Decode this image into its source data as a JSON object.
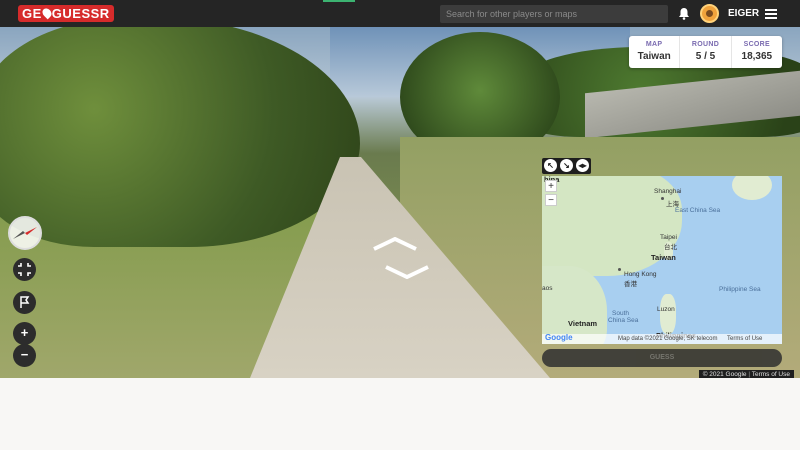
{
  "app": {
    "logo_text_left": "GE",
    "logo_text_right": "GUESSR",
    "brand_color": "#d62b2b",
    "search_placeholder": "Search for other players or maps",
    "username": "EIGER"
  },
  "scoreboard": {
    "map_label": "MAP",
    "map_value": "Taiwan",
    "round_label": "ROUND",
    "round_value": "5 / 5",
    "score_label": "SCORE",
    "score_value": "18,365"
  },
  "controls": {
    "zoom_in": "+",
    "zoom_out": "−"
  },
  "map": {
    "zoom_in": "+",
    "zoom_out": "−",
    "labels": {
      "china": "hina",
      "shanghai": "Shanghai",
      "shanghai_cn": "上海",
      "east_china_sea": "East China Sea",
      "taipei": "Taipei",
      "taipei_cn": "台北",
      "taiwan": "Taiwan",
      "hong_kong": "Hong Kong",
      "hong_kong_cn": "香港",
      "philippine_sea": "Philippine Sea",
      "aos": "aos",
      "south_china_sea_1": "South",
      "south_china_sea_2": "China Sea",
      "luzon": "Luzon",
      "vietnam": "Vietnam",
      "philippines": "Philippines"
    },
    "attribution": "Map data ©2021 Google, SK telecom",
    "terms": "Terms of Use",
    "google_logo": "Google"
  },
  "guess_button": "GUESS",
  "pano_footer": {
    "copyright": "© 2021 Google",
    "terms": "Terms of Use"
  }
}
